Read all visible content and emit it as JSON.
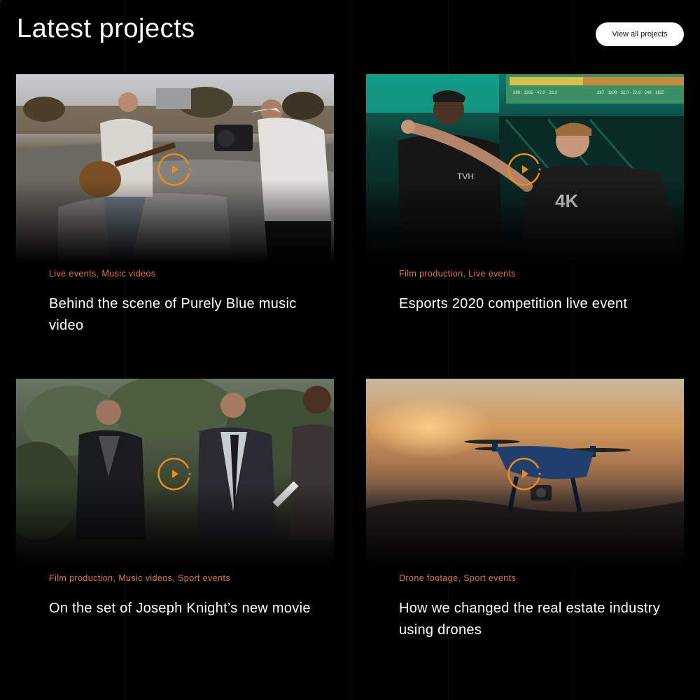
{
  "header": {
    "title": "Latest projects",
    "view_all_label": "View all projects"
  },
  "colors": {
    "background": "#000000",
    "accent": "#e07a2c",
    "button_bg": "#ffffff",
    "text": "#ffffff"
  },
  "projects": [
    {
      "tags": [
        "Live events",
        "Music videos"
      ],
      "title": "Behind the scene of Purely Blue music video",
      "thumbnail": "guitarist-on-beach-with-camera-operator-photo",
      "play_icon": "play-circle-icon"
    },
    {
      "tags": [
        "Film production",
        "Live events"
      ],
      "title": "Esports 2020 competition live event",
      "thumbnail": "esports-hosts-in-front-of-scoreboard-photo",
      "play_icon": "play-circle-icon"
    },
    {
      "tags": [
        "Film production",
        "Music videos",
        "Sport events"
      ],
      "title": "On the set of Joseph Knight’s new movie",
      "thumbnail": "three-men-in-forest-film-set-photo",
      "play_icon": "play-circle-icon"
    },
    {
      "tags": [
        "Drone footage",
        "Sport events"
      ],
      "title": "How we changed the real estate industry using drones",
      "thumbnail": "drone-flying-at-sunset-photo",
      "play_icon": "play-circle-icon"
    }
  ]
}
